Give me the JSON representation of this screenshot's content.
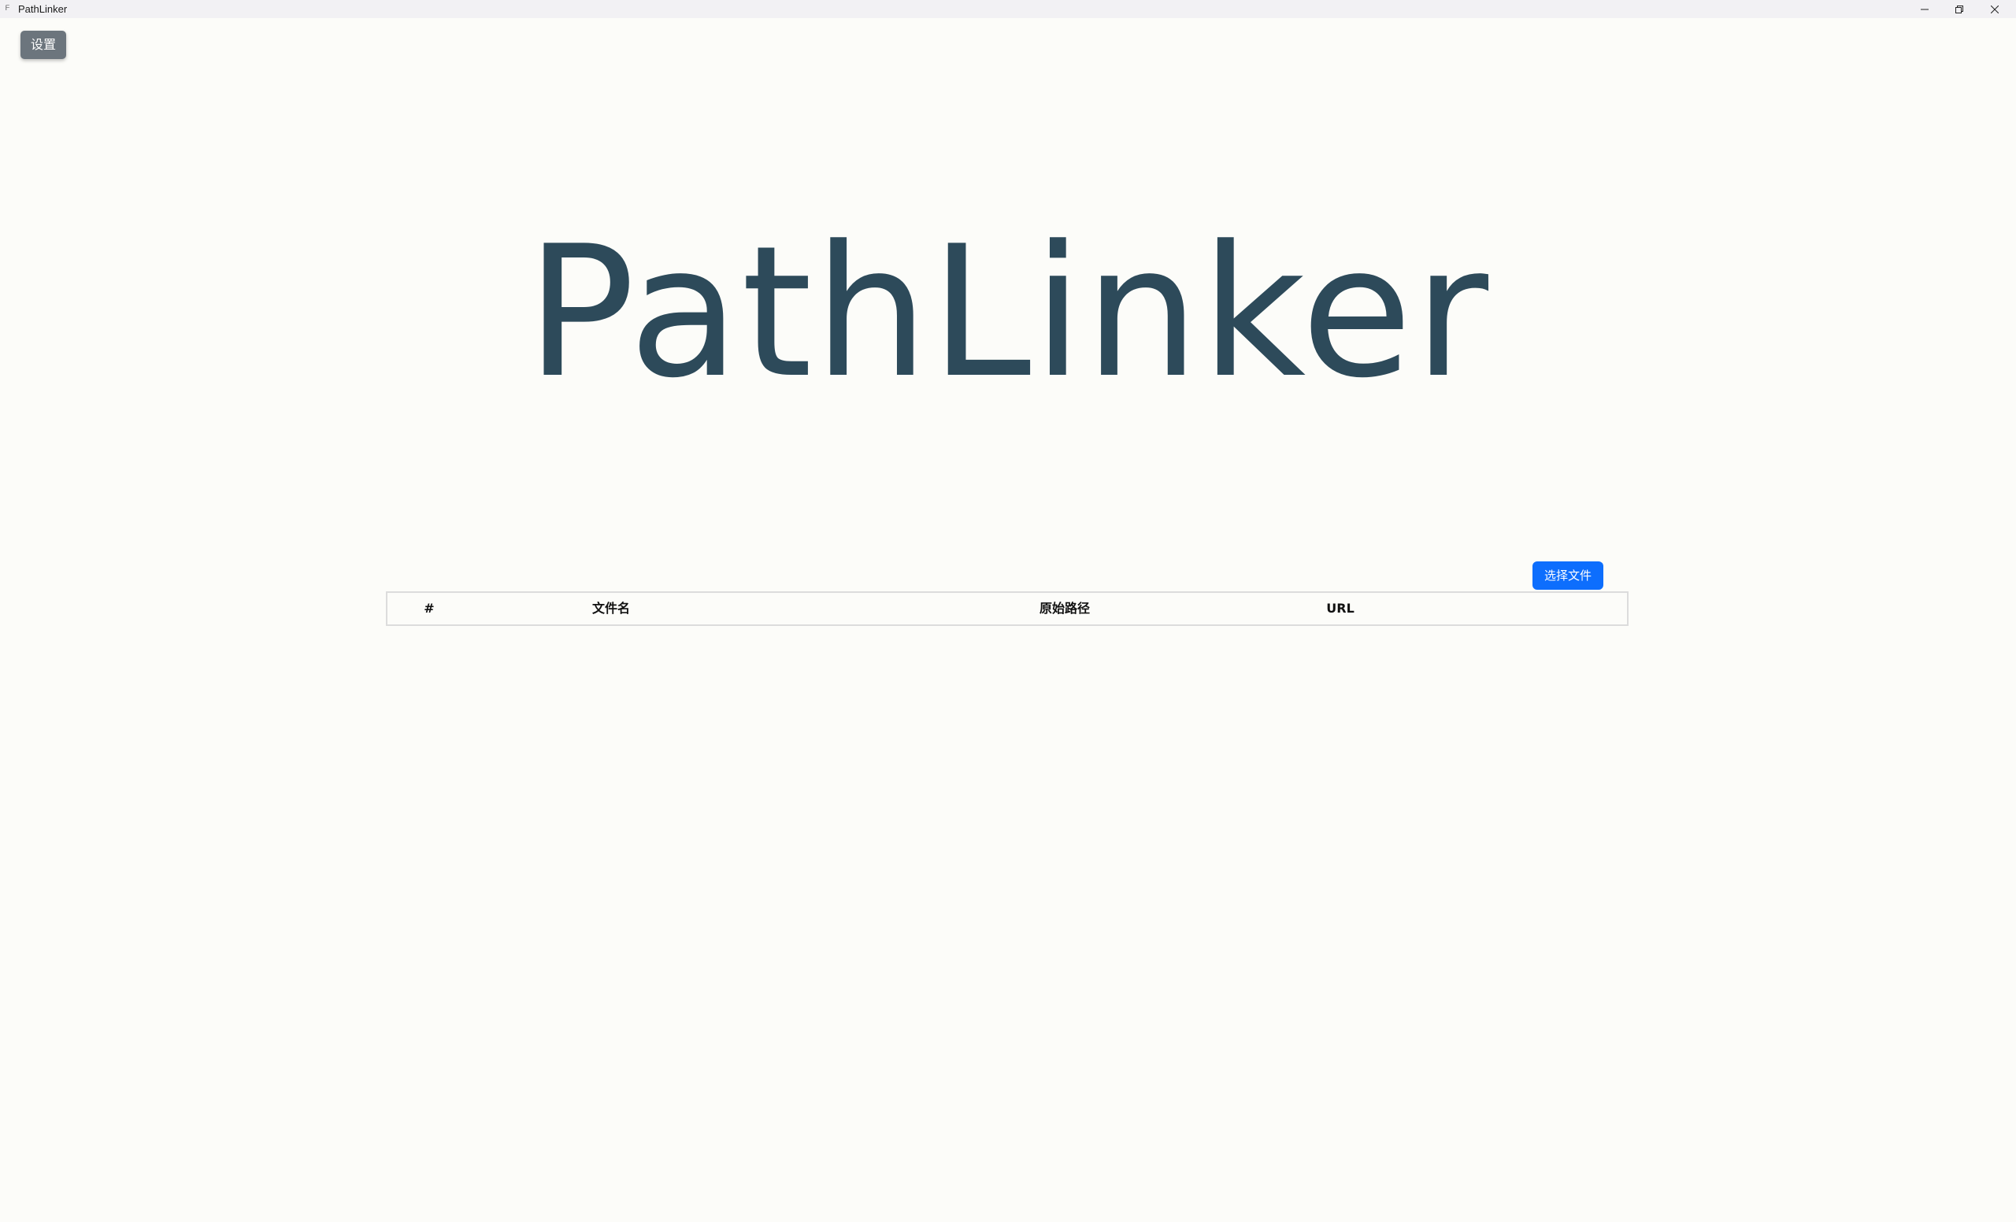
{
  "window": {
    "title": "PathLinker",
    "icon": "app-icon"
  },
  "toolbar": {
    "settings_label": "设置"
  },
  "hero": {
    "title": "PathLinker"
  },
  "actions": {
    "select_file_label": "选择文件"
  },
  "table": {
    "columns": [
      "#",
      "文件名",
      "原始路径",
      "URL"
    ],
    "rows": []
  }
}
